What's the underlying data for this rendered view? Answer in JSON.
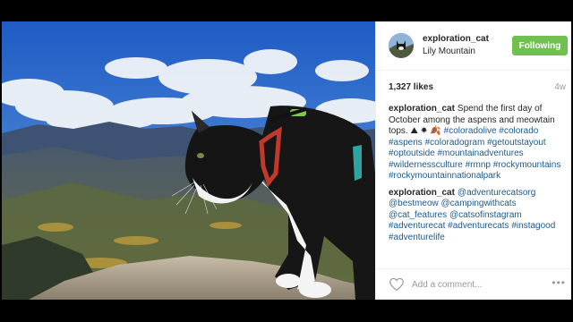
{
  "post": {
    "username": "exploration_cat",
    "location": "Lily Mountain",
    "follow_label": "Following",
    "likes": "1,327 likes",
    "age": "4w",
    "comments": [
      {
        "user": "exploration_cat",
        "text": "Spend the first day of October among the aspens and meowtain tops.",
        "emoji": "⛰ ☀ 🍂",
        "tags": [
          "#coloradolive",
          "#colorado",
          "#aspens",
          "#coloradogram",
          "#getoutstayout",
          "#optoutside",
          "#mountainadventures",
          "#wildernessculture",
          "#rmnp",
          "#rockymountains",
          "#rockymountainnationalpark"
        ]
      },
      {
        "user": "exploration_cat",
        "text": "",
        "tags": [
          "@adventurecatsorg",
          "@bestmeow",
          "@campingwithcats",
          "@cat_features",
          "@catsofinstagram",
          "#adventurecat",
          "#adventurecats",
          "#instagood",
          "#adventurelife"
        ]
      }
    ],
    "add_comment_placeholder": "Add a comment...",
    "more_label": "•••"
  },
  "icons": {
    "like": "heart-outline-icon",
    "more": "more-options-icon"
  },
  "colors": {
    "follow": "#70c050",
    "link": "#1c5a8e",
    "sky": "#2f6fc7"
  }
}
